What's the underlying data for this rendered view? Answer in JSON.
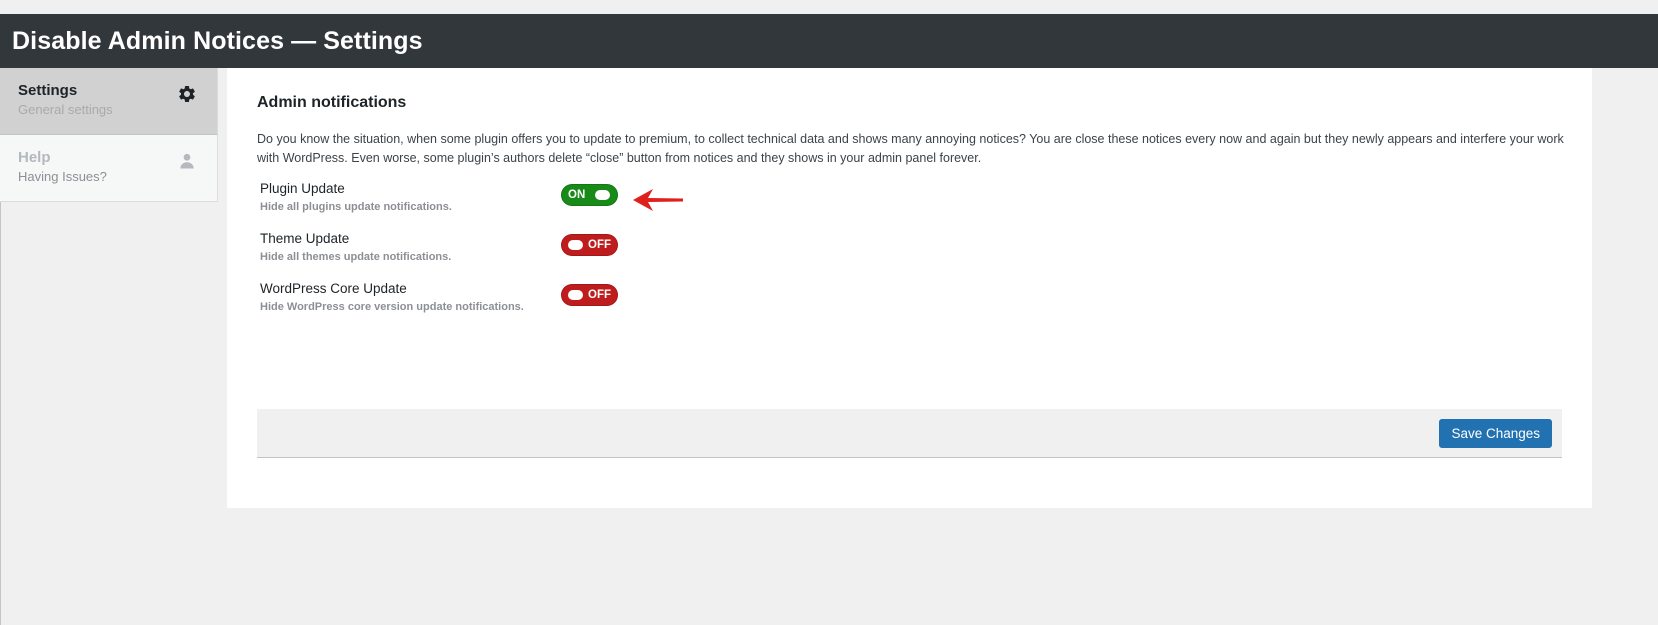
{
  "header": {
    "title": "Disable Admin Notices — Settings"
  },
  "sidebar": {
    "items": [
      {
        "title": "Settings",
        "subtitle": "General settings",
        "icon": "gear-icon"
      },
      {
        "title": "Help",
        "subtitle": "Having Issues?",
        "icon": "user-icon"
      }
    ]
  },
  "main": {
    "section_title": "Admin notifications",
    "description": "Do you know the situation, when some plugin offers you to update to premium, to collect technical data and shows many annoying notices? You are close these notices every now and again but they newly appears and interfere your work with WordPress. Even worse, some plugin’s authors delete “close” button from notices and they shows in your admin panel forever.",
    "options": [
      {
        "label": "Plugin Update",
        "hint": "Hide all plugins update notifications.",
        "state": "ON"
      },
      {
        "label": "Theme Update",
        "hint": "Hide all themes update notifications.",
        "state": "OFF"
      },
      {
        "label": "WordPress Core Update",
        "hint": "Hide WordPress core version update notifications.",
        "state": "OFF"
      }
    ],
    "save_label": "Save Changes"
  },
  "colors": {
    "titlebar": "#32373c",
    "toggle_on": "#178a17",
    "toggle_off": "#bf1d1d",
    "primary_button": "#2271b1",
    "arrow": "#e0201c"
  }
}
